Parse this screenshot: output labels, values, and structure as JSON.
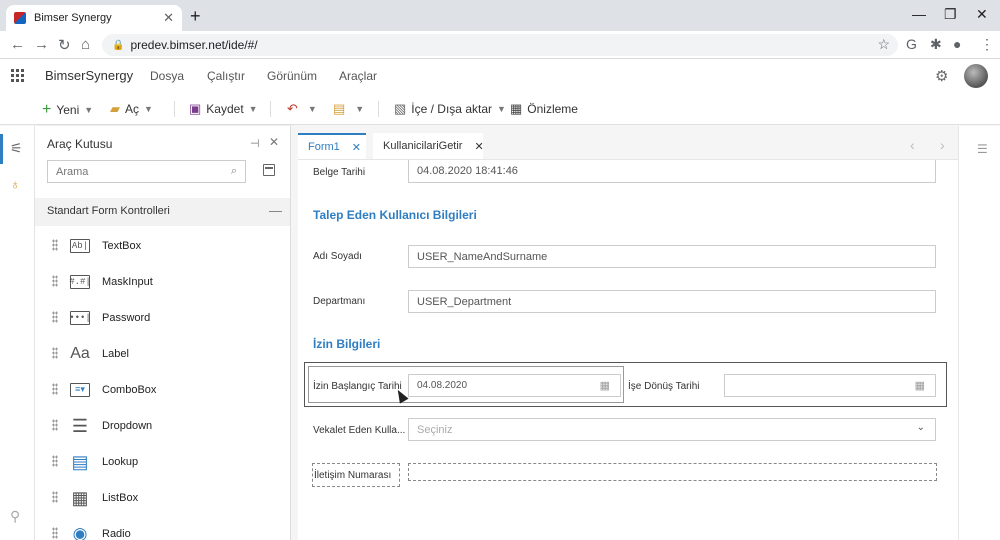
{
  "browser": {
    "tab_title": "Bimser Synergy",
    "tab_close": "✕",
    "new_tab": "+",
    "url": "predev.bimser.net/ide/#/",
    "win_min": "—",
    "win_max": "❐",
    "win_close": "✕"
  },
  "app": {
    "brand": "BimserSynergy",
    "menu": [
      "Dosya",
      "Çalıştır",
      "Görünüm",
      "Araçlar"
    ]
  },
  "toolbar": {
    "new_label": "Yeni",
    "open_label": "Aç",
    "save_label": "Kaydet",
    "import_export_label": "İçe / Dışa aktar",
    "preview_label": "Önizleme"
  },
  "toolbox": {
    "title": "Araç Kutusu",
    "search_placeholder": "Arama",
    "category": "Standart Form Kontrolleri",
    "items": [
      {
        "label": "TextBox",
        "icon": "Ab|"
      },
      {
        "label": "MaskInput",
        "icon": "#.#|"
      },
      {
        "label": "Password",
        "icon": "•••|"
      },
      {
        "label": "Label",
        "icon": "Aa"
      },
      {
        "label": "ComboBox",
        "icon": "≡▾"
      },
      {
        "label": "Dropdown",
        "icon": "☰"
      },
      {
        "label": "Lookup",
        "icon": "▤"
      },
      {
        "label": "ListBox",
        "icon": "▦"
      },
      {
        "label": "Radio",
        "icon": "◉"
      }
    ]
  },
  "designer": {
    "tabs": [
      "Form1",
      "KullanicilariGetir"
    ],
    "tab_close": "✕",
    "fields": {
      "belge_tarihi_label": "Belge Tarihi",
      "belge_tarihi_value": "04.08.2020 18:41:46",
      "section1": "Talep Eden Kullanıcı Bilgileri",
      "adi_soyadi_label": "Adı Soyadı",
      "adi_soyadi_value": "USER_NameAndSurname",
      "departman_label": "Departmanı",
      "departman_value": "USER_Department",
      "section2": "İzin Bilgileri",
      "izin_baslangic_label": "İzin Başlangıç Tarihi",
      "izin_baslangic_value": "04.08.2020",
      "ise_donus_label": "İşe Dönüş Tarihi",
      "ise_donus_value": "",
      "vekalet_label": "Vekalet Eden Kulla...",
      "vekalet_placeholder": "Seçiniz",
      "iletisim_label": "İletişim Numarası",
      "iletisim_value": ""
    }
  },
  "colors": {
    "accent": "#2f7ec2"
  }
}
